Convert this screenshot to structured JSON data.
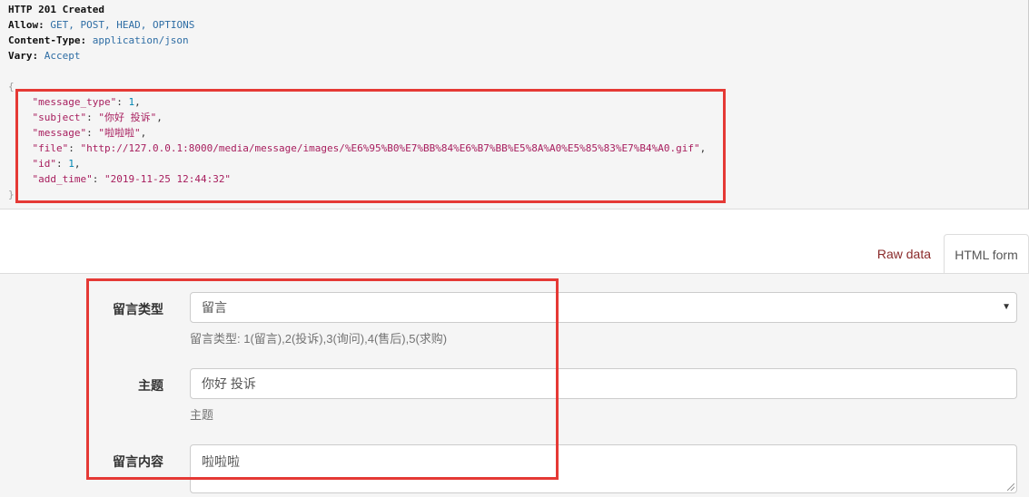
{
  "response": {
    "status_line": "HTTP 201 Created",
    "headers": [
      {
        "name": "Allow:",
        "value": "GET, POST, HEAD, OPTIONS"
      },
      {
        "name": "Content-Type:",
        "value": "application/json"
      },
      {
        "name": "Vary:",
        "value": "Accept"
      }
    ],
    "json": {
      "open_brace": "{",
      "close_brace": "}",
      "message_type_key": "\"message_type\"",
      "message_type_val": "1",
      "subject_key": "\"subject\"",
      "subject_val": "\"你好 投诉\"",
      "message_key": "\"message\"",
      "message_val": "\"啦啦啦\"",
      "file_key": "\"file\"",
      "file_val": "\"http://127.0.0.1:8000/media/message/images/%E6%95%B0%E7%BB%84%E6%B7%BB%E5%8A%A0%E5%85%83%E7%B4%A0.gif\"",
      "id_key": "\"id\"",
      "id_val": "1",
      "add_time_key": "\"add_time\"",
      "add_time_val": "\"2019-11-25 12:44:32\""
    }
  },
  "tabs": {
    "raw": "Raw data",
    "html": "HTML form"
  },
  "form": {
    "message_type": {
      "label": "留言类型",
      "value": "留言",
      "caret": "▼",
      "help": "留言类型: 1(留言),2(投诉),3(询问),4(售后),5(求购)"
    },
    "subject": {
      "label": "主题",
      "value": "你好 投诉",
      "help": "主题"
    },
    "message": {
      "label": "留言内容",
      "value": "啦啦啦"
    }
  },
  "colors": {
    "highlight_box": "#e53935",
    "tab_raw": "#8a2a2a"
  }
}
